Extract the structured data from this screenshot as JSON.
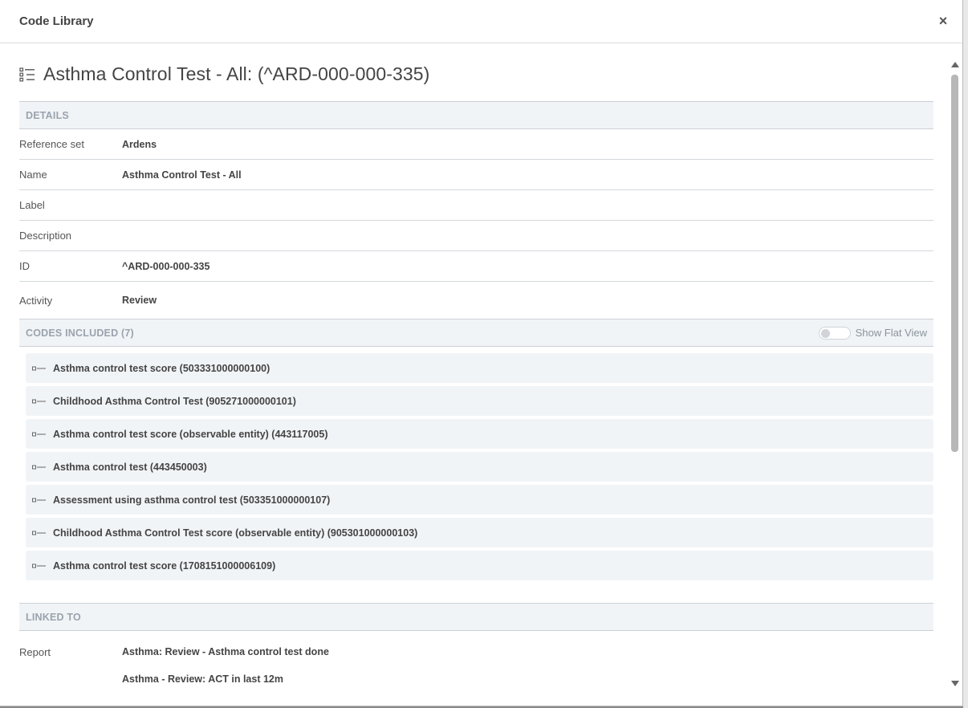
{
  "modal": {
    "title": "Code Library",
    "close_label": "×"
  },
  "page": {
    "title": "Asthma Control Test - All: (^ARD-000-000-335)",
    "title_icon": "list-tree-icon"
  },
  "details": {
    "heading": "DETAILS",
    "rows": [
      {
        "label": "Reference set",
        "value": "Ardens"
      },
      {
        "label": "Name",
        "value": "Asthma Control Test - All"
      },
      {
        "label": "Label",
        "value": ""
      },
      {
        "label": "Description",
        "value": ""
      },
      {
        "label": "ID",
        "value": "^ARD-000-000-335"
      },
      {
        "label": "Activity",
        "value": "Review"
      }
    ]
  },
  "codes": {
    "heading": "CODES INCLUDED (7)",
    "flat_view_label": "Show Flat View",
    "flat_view_on": false,
    "items": [
      "Asthma control test score (503331000000100)",
      "Childhood Asthma Control Test (905271000000101)",
      "Asthma control test score (observable entity) (443117005)",
      "Asthma control test (443450003)",
      "Assessment using asthma control test (503351000000107)",
      "Childhood Asthma Control Test score (observable entity) (905301000000103)",
      "Asthma control test score (1708151000006109)"
    ]
  },
  "linked": {
    "heading": "LINKED TO",
    "label": "Report",
    "values": [
      "Asthma: Review - Asthma control test done",
      "Asthma - Review: ACT in last 12m"
    ]
  },
  "colors": {
    "section_bg": "#f1f4f7",
    "section_text": "#9aa3ad",
    "border": "#ccd1d6"
  }
}
